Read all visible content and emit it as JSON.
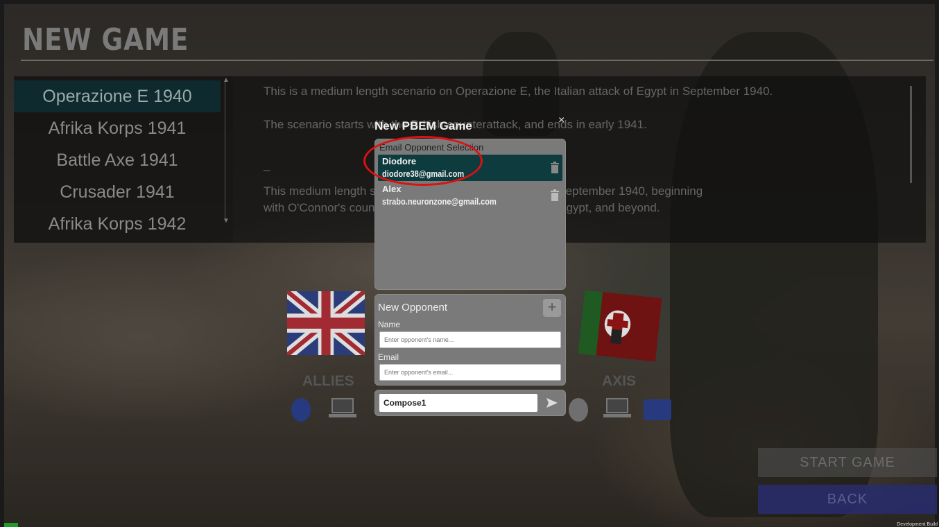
{
  "screen": {
    "title": "NEW GAME"
  },
  "scenarios": [
    {
      "label": "Operazione E 1940",
      "selected": true
    },
    {
      "label": "Afrika Korps 1941",
      "selected": false
    },
    {
      "label": "Battle Axe 1941",
      "selected": false
    },
    {
      "label": "Crusader 1941",
      "selected": false
    },
    {
      "label": "Afrika Korps 1942",
      "selected": false
    }
  ],
  "description": {
    "line1": "This is a medium length scenario on Operazione E, the Italian attack of Egypt in September 1940.",
    "line2": "The scenario starts with the British counterattack, and ends in early 1941.",
    "line3": "_",
    "line4": "This medium length scenario recreates Operazione E in September 1940, beginning",
    "line5": "with O'Connor's counterattack to drive the Italians out of Egypt, and beyond."
  },
  "sides": {
    "allies_label": "ALLIES",
    "axis_label": "AXIS"
  },
  "buttons": {
    "start_game": "START GAME",
    "back": "BACK"
  },
  "dialog": {
    "title": "New PBEM Game",
    "close": "×",
    "opponent_selection_heading": "Email Opponent Selection",
    "opponents": [
      {
        "name": "Diodore",
        "email": "diodore38@gmail.com",
        "selected": true
      },
      {
        "name": "Alex",
        "email": "strabo.neuronzone@gmail.com",
        "selected": false
      }
    ],
    "new_opponent": {
      "title": "New Opponent",
      "add": "+",
      "name_label": "Name",
      "name_placeholder": "Enter opponent's name...",
      "email_label": "Email",
      "email_placeholder": "Enter opponent's email..."
    },
    "compose": {
      "value": "Compose1"
    }
  },
  "footer": {
    "dev_build": "Development Build"
  },
  "colors": {
    "selected_row": "#0e3b3e",
    "highlight": "#dd1111",
    "back_button": "#282d6e",
    "allies_blue": "#273a80"
  }
}
